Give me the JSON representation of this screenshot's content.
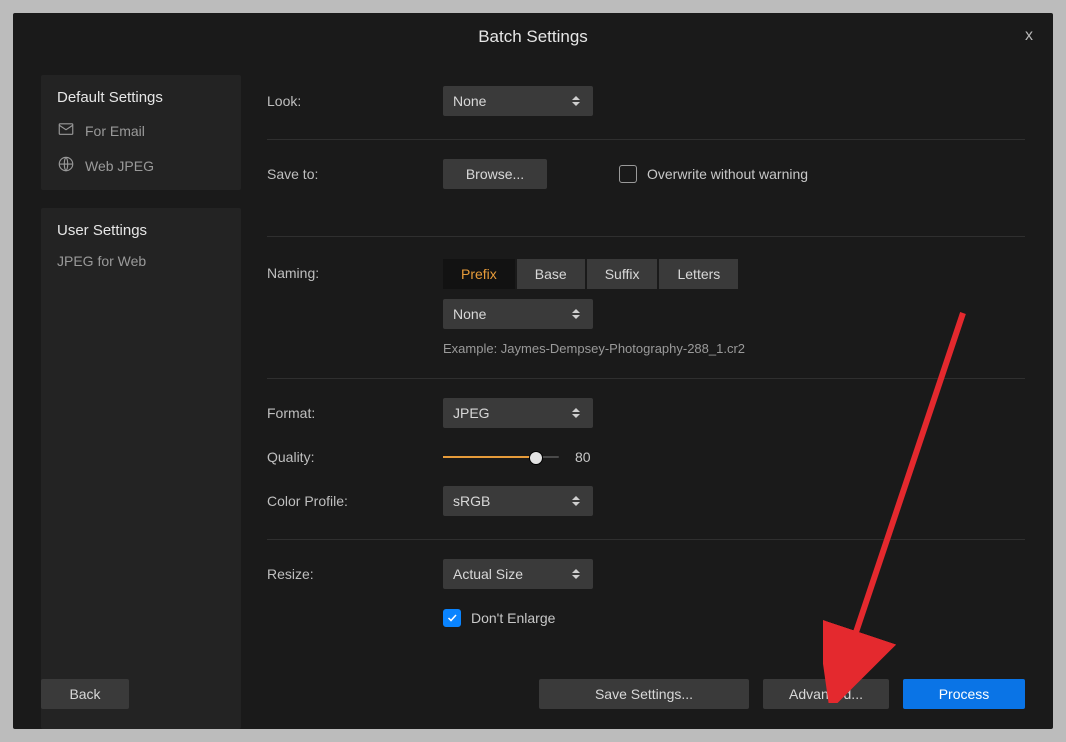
{
  "title": "Batch Settings",
  "close_glyph": "x",
  "sidebar": {
    "default_header": "Default Settings",
    "default_items": [
      {
        "label": "For Email",
        "icon": "mail"
      },
      {
        "label": "Web JPEG",
        "icon": "globe"
      }
    ],
    "user_header": "User Settings",
    "user_items": [
      {
        "label": "JPEG for Web"
      }
    ]
  },
  "labels": {
    "look": "Look:",
    "save_to": "Save to:",
    "naming": "Naming:",
    "format": "Format:",
    "quality": "Quality:",
    "color_profile": "Color Profile:",
    "resize": "Resize:"
  },
  "look_value": "None",
  "browse_label": "Browse...",
  "overwrite_label": "Overwrite without warning",
  "overwrite_checked": false,
  "naming_tabs": [
    "Prefix",
    "Base",
    "Suffix",
    "Letters"
  ],
  "naming_active": "Prefix",
  "naming_value": "None",
  "naming_example": "Example: Jaymes-Dempsey-Photography-288_1.cr2",
  "format_value": "JPEG",
  "quality_value": "80",
  "quality_percent": 80,
  "color_profile_value": "sRGB",
  "resize_value": "Actual Size",
  "dont_enlarge_label": "Don't Enlarge",
  "dont_enlarge_checked": true,
  "footer": {
    "back": "Back",
    "save": "Save Settings...",
    "advanced": "Advanced...",
    "process": "Process"
  },
  "annotation": {
    "arrow_color": "#e4292e"
  }
}
